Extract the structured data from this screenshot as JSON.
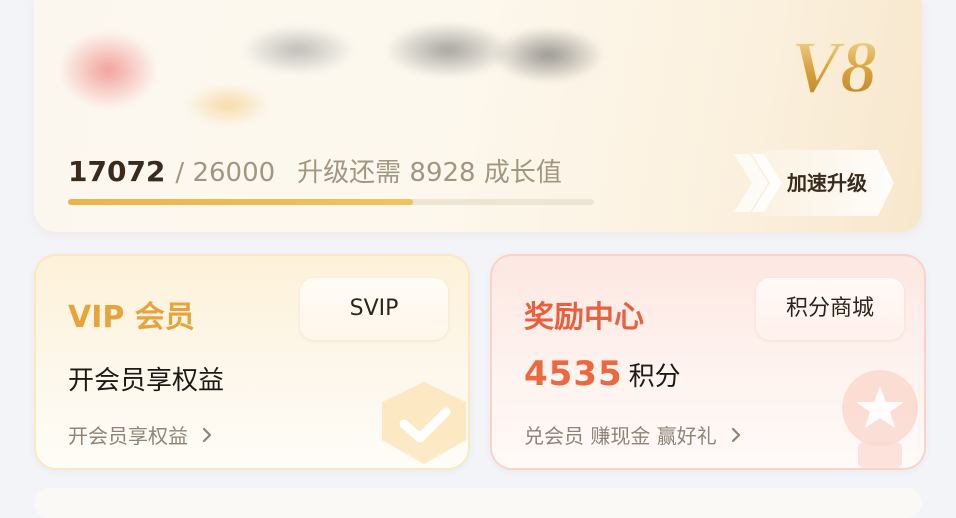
{
  "level_card": {
    "level_badge": "V8",
    "current_growth": "17072",
    "total_growth": "/ 26000",
    "upgrade_hint": "升级还需 8928 成长值",
    "progress_fraction": 0.6566,
    "speed_up_label": "加速升级"
  },
  "vip_card": {
    "title": "VIP 会员",
    "tag": "SVIP",
    "main_text": "开会员享权益",
    "link_text": "开会员享权益"
  },
  "reward_card": {
    "title": "奖励中心",
    "tag": "积分商城",
    "points_value": "4535",
    "points_unit": "积分",
    "link_text": "兑会员 赚现金 赢好礼"
  },
  "icons": [
    "chevron-right-icon",
    "check-shield-icon",
    "star-medal-icon",
    "double-chevron-icon"
  ],
  "colors": {
    "vip_accent": "#e7a43c",
    "reward_accent": "#ec6940",
    "progress": "#e9b44c"
  }
}
